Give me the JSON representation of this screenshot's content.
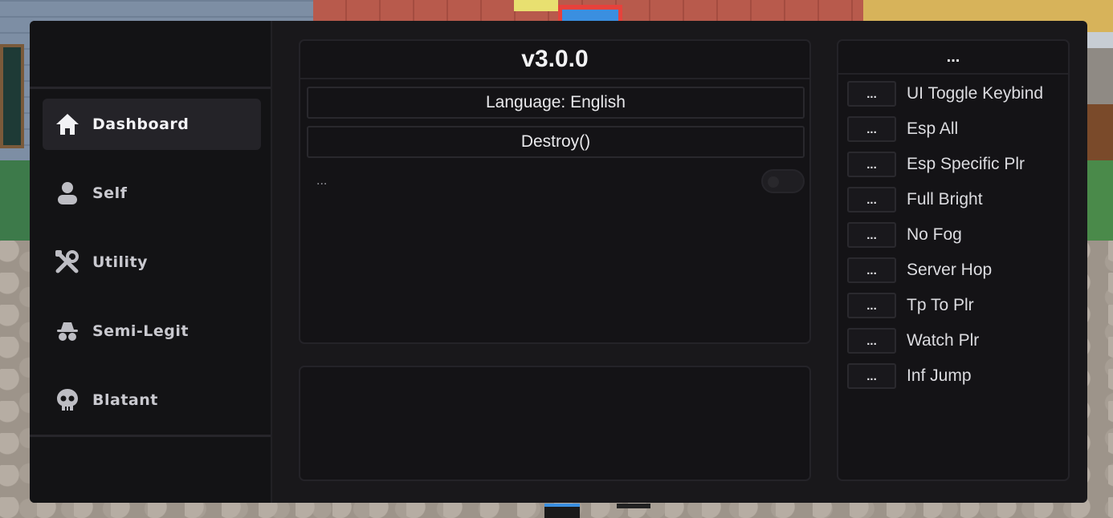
{
  "sidebar": {
    "items": [
      {
        "label": "Dashboard",
        "icon": "home-icon",
        "active": true
      },
      {
        "label": "Self",
        "icon": "user-icon",
        "active": false
      },
      {
        "label": "Utility",
        "icon": "tools-icon",
        "active": false
      },
      {
        "label": "Semi-Legit",
        "icon": "incognito-icon",
        "active": false
      },
      {
        "label": "Blatant",
        "icon": "skull-icon",
        "active": false
      }
    ]
  },
  "main": {
    "version": "v3.0.0",
    "language_button": "Language: English",
    "destroy_button": "Destroy()",
    "toggle_label": "...",
    "toggle_on": false
  },
  "keybinds": {
    "title": "...",
    "items": [
      {
        "key": "...",
        "label": "UI Toggle Keybind"
      },
      {
        "key": "...",
        "label": "Esp All"
      },
      {
        "key": "...",
        "label": "Esp Specific Plr"
      },
      {
        "key": "...",
        "label": "Full Bright"
      },
      {
        "key": "...",
        "label": "No Fog"
      },
      {
        "key": "...",
        "label": "Server Hop"
      },
      {
        "key": "...",
        "label": "Tp To Plr"
      },
      {
        "key": "...",
        "label": "Watch Plr"
      },
      {
        "key": "...",
        "label": "Inf Jump"
      }
    ]
  },
  "colors": {
    "window_bg": "#19181b",
    "sidebar_bg": "#131315",
    "active_item_bg": "#242328",
    "text_primary": "#f3f3f5"
  }
}
